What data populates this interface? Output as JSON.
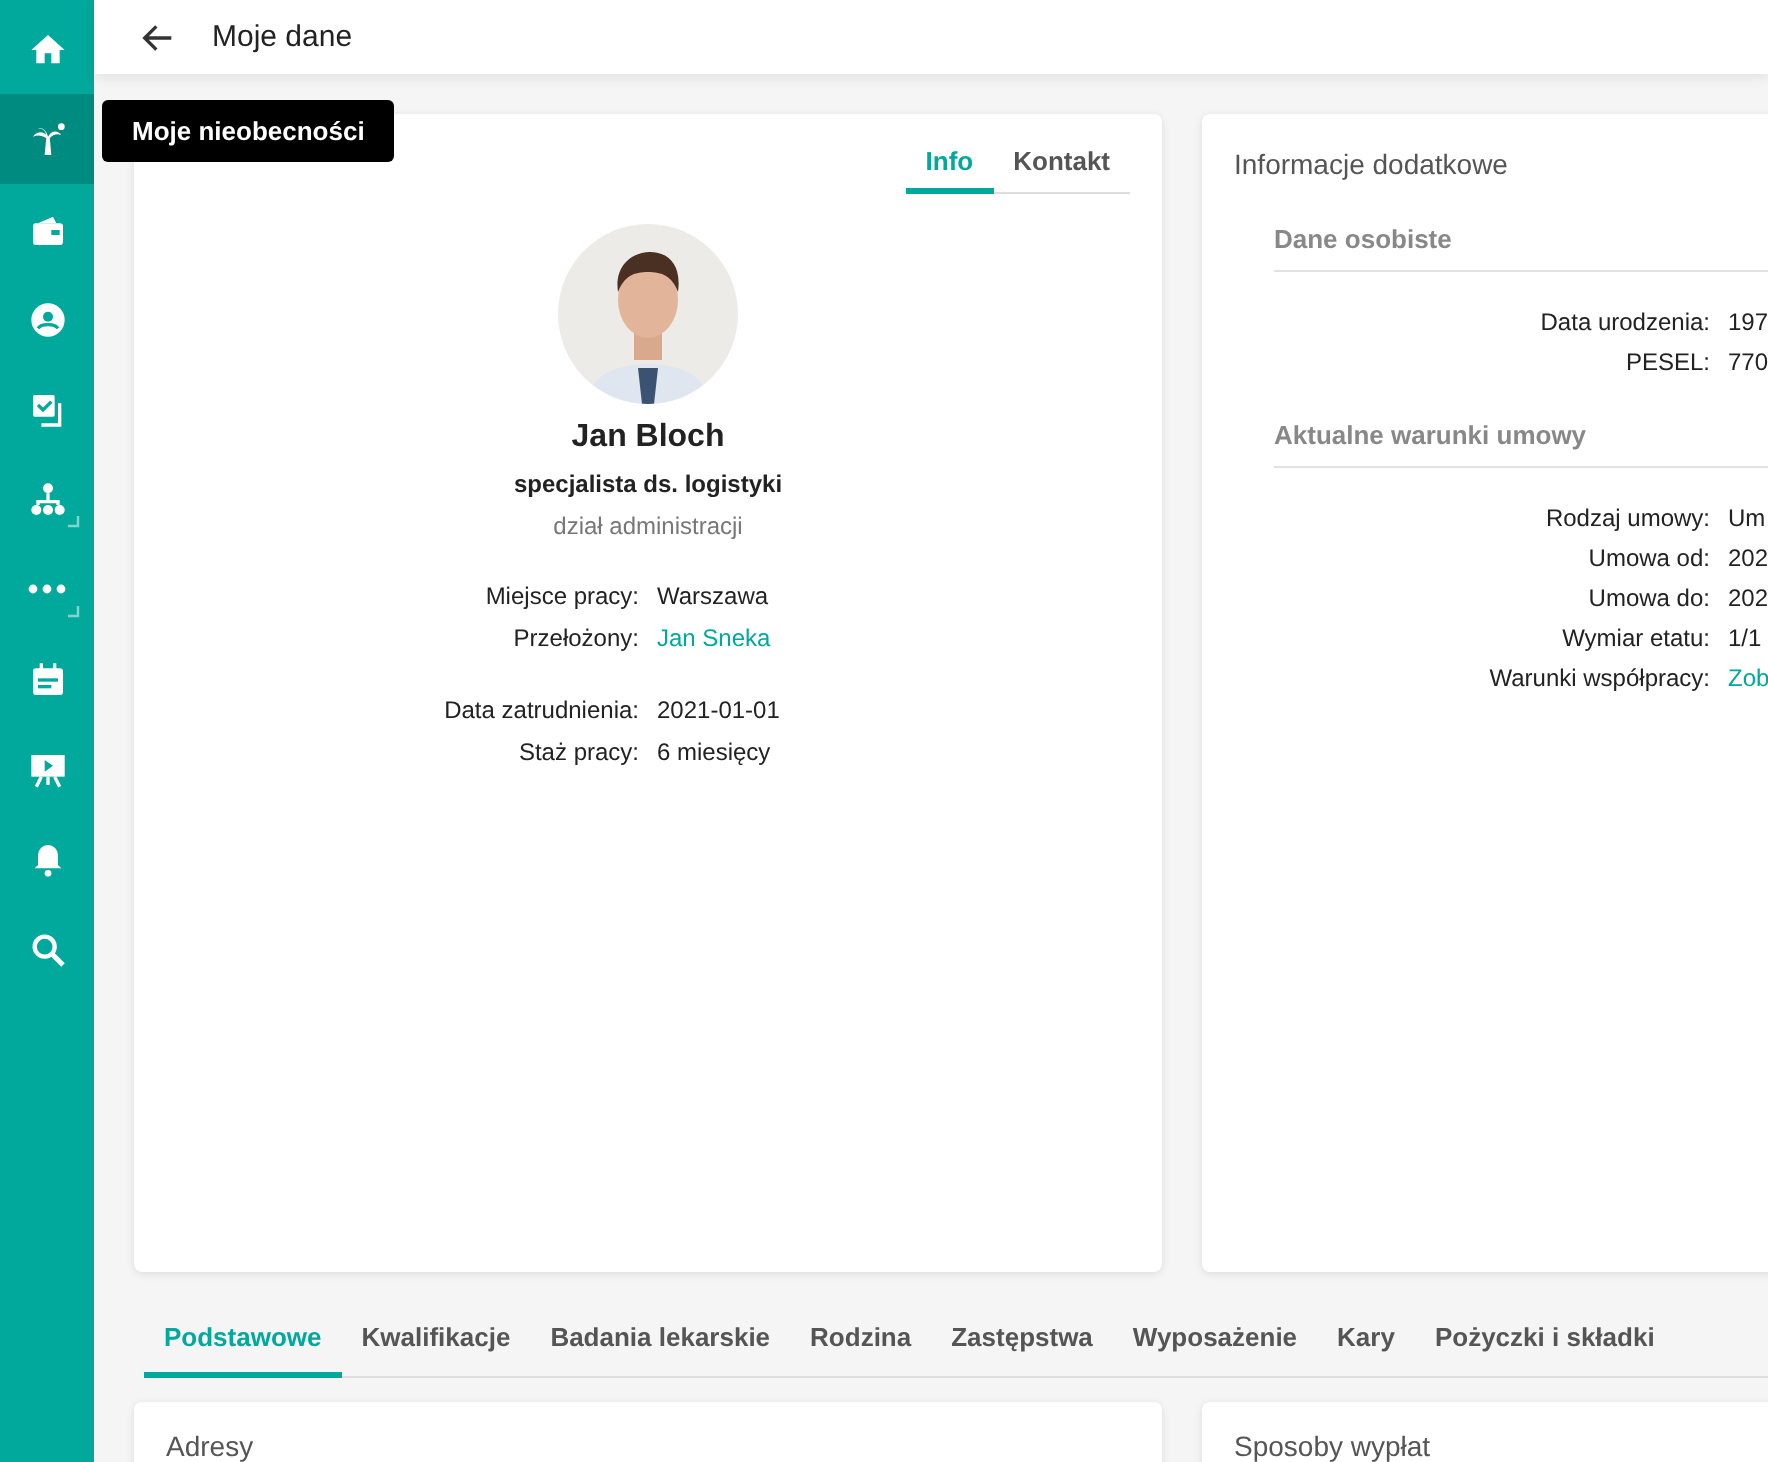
{
  "sidebar": {
    "items": [
      {
        "selected": false,
        "expandable": false
      },
      {
        "selected": true,
        "expandable": false
      },
      {
        "selected": false,
        "expandable": false
      },
      {
        "selected": false,
        "expandable": false
      },
      {
        "selected": false,
        "expandable": false
      },
      {
        "selected": false,
        "expandable": true
      },
      {
        "selected": false,
        "expandable": true
      },
      {
        "selected": false,
        "expandable": false
      },
      {
        "selected": false,
        "expandable": false
      },
      {
        "selected": false,
        "expandable": false
      },
      {
        "selected": false,
        "expandable": false
      }
    ]
  },
  "tooltip": "Moje nieobecności",
  "header": {
    "title": "Moje dane"
  },
  "employee_card": {
    "tabs": [
      {
        "label": "Info",
        "selected": true
      },
      {
        "label": "Kontakt",
        "selected": false
      }
    ],
    "name": "Jan Bloch",
    "position": "specjalista ds. logistyki",
    "department": "dział administracji",
    "groups": [
      [
        {
          "label": "Miejsce pracy:",
          "value": "Warszawa",
          "link": false
        },
        {
          "label": "Przełożony:",
          "value": "Jan Sneka",
          "link": true
        }
      ],
      [
        {
          "label": "Data zatrudnienia:",
          "value": "2021-01-01",
          "link": false
        },
        {
          "label": "Staż pracy:",
          "value": "6 miesięcy",
          "link": false
        }
      ]
    ]
  },
  "extra_card": {
    "title": "Informacje dodatkowe",
    "sections": [
      {
        "heading": "Dane osobiste",
        "rows": [
          {
            "label": "Data urodzenia:",
            "value": "197",
            "link": false
          },
          {
            "label": "PESEL:",
            "value": "770",
            "link": false
          }
        ]
      },
      {
        "heading": "Aktualne warunki umowy",
        "rows": [
          {
            "label": "Rodzaj umowy:",
            "value": "Um",
            "link": false
          },
          {
            "label": "Umowa od:",
            "value": "202",
            "link": false
          },
          {
            "label": "Umowa do:",
            "value": "202",
            "link": false
          },
          {
            "label": "Wymiar etatu:",
            "value": "1/1",
            "link": false
          },
          {
            "label": "Warunki współpracy:",
            "value": "Zob",
            "link": true
          }
        ]
      }
    ]
  },
  "bottom_tabs": [
    {
      "label": "Podstawowe",
      "selected": true
    },
    {
      "label": "Kwalifikacje",
      "selected": false
    },
    {
      "label": "Badania lekarskie",
      "selected": false
    },
    {
      "label": "Rodzina",
      "selected": false
    },
    {
      "label": "Zastępstwa",
      "selected": false
    },
    {
      "label": "Wyposażenie",
      "selected": false
    },
    {
      "label": "Kary",
      "selected": false
    },
    {
      "label": "Pożyczki i składki",
      "selected": false
    }
  ],
  "bottom_cards": [
    {
      "title": "Adresy"
    },
    {
      "title": "Sposoby wypłat"
    }
  ]
}
